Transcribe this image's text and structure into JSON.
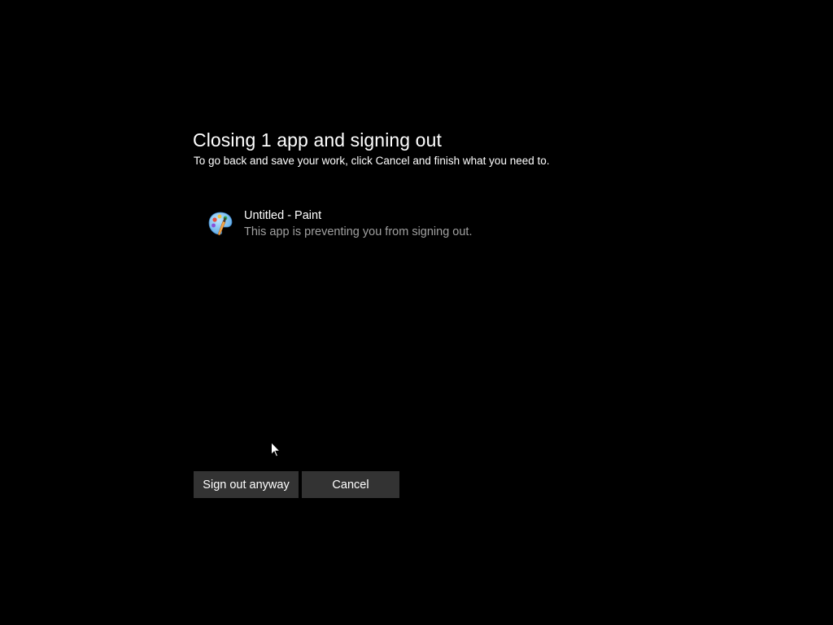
{
  "dialog": {
    "title": "Closing 1 app and signing out",
    "subtitle": "To go back and save your work, click Cancel and finish what you need to."
  },
  "apps": [
    {
      "name": "Untitled - Paint",
      "description": "This app is preventing you from signing out.",
      "icon": "paint-palette-icon"
    }
  ],
  "buttons": {
    "sign_out_label": "Sign out anyway",
    "cancel_label": "Cancel"
  },
  "colors": {
    "background": "#000000",
    "button": "#333333",
    "secondary_text": "#a0a0a0"
  }
}
